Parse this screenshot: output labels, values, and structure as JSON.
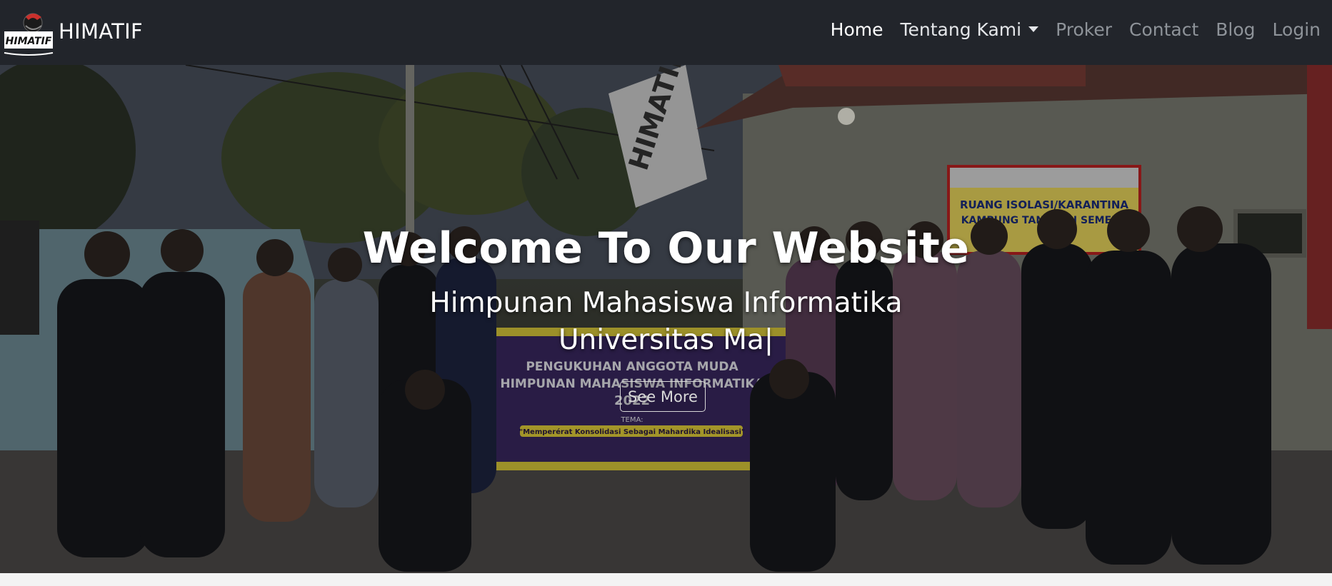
{
  "brand": {
    "logo_text": "HIMATIF",
    "name": "HIMATIF"
  },
  "nav": {
    "items": [
      {
        "label": "Home"
      },
      {
        "label": "Tentang Kami"
      },
      {
        "label": "Proker"
      },
      {
        "label": "Contact"
      },
      {
        "label": "Blog"
      },
      {
        "label": "Login"
      }
    ]
  },
  "hero": {
    "title": "Welcome To Our Website",
    "subtitle_line1": "Himpunan Mahasiswa Informatika",
    "subtitle_line2": "Universitas Ma",
    "button": "See More",
    "flag_text": "HIMATIF",
    "sign_line1": "RUANG ISOLASI/KARANTINA",
    "sign_line2": "KAMPUNG TANGGUH SEMERU",
    "banner_line1": "PENGUKUHAN ANGGOTA MUDA",
    "banner_line2": "HIMPUNAN MAHASISWA INFORMATIKA",
    "banner_line3": "2022",
    "banner_tema_label": "TEMA:",
    "banner_tema": "\"Memperérat Konsolidasi Sebagai Mahardika Idealisasi\""
  },
  "colors": {
    "navbar": "#22252b",
    "nav_active": "#ffffff",
    "nav_muted": "#8e9399"
  }
}
